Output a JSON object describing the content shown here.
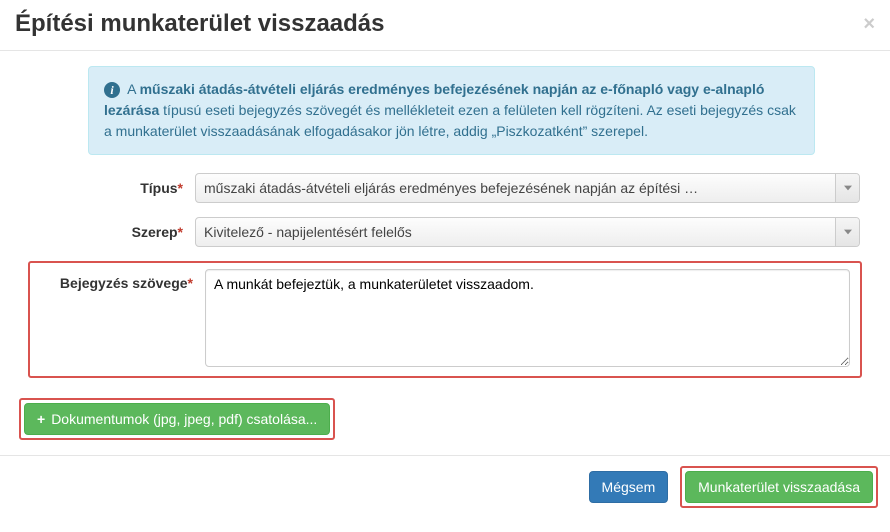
{
  "header": {
    "title": "Építési munkaterület visszaadás",
    "close": "×"
  },
  "info": {
    "prefix": "A ",
    "bold": "műszaki átadás-átvételi eljárás eredményes befejezésének napján az e-főnapló vagy e-alnapló lezárása",
    "rest": " típusú eseti bejegyzés szövegét és mellékleteit ezen a felületen kell rögzíteni. Az eseti bejegyzés csak a munkaterület visszaadásának elfogadásakor jön létre, addig „Piszkozatként” szerepel."
  },
  "form": {
    "type_label": "Típus",
    "type_value": "műszaki átadás-átvételi eljárás eredményes befejezésének napján az építési …",
    "role_label": "Szerep",
    "role_value": "Kivitelező - napijelentésért felelős",
    "text_label": "Bejegyzés szövege",
    "text_value": "A munkát befejeztük, a munkaterületet visszaadom."
  },
  "attach": {
    "button": "Dokumentumok (jpg, jpeg, pdf) csatolása..."
  },
  "footer": {
    "cancel": "Mégsem",
    "submit": "Munkaterület visszaadása"
  }
}
